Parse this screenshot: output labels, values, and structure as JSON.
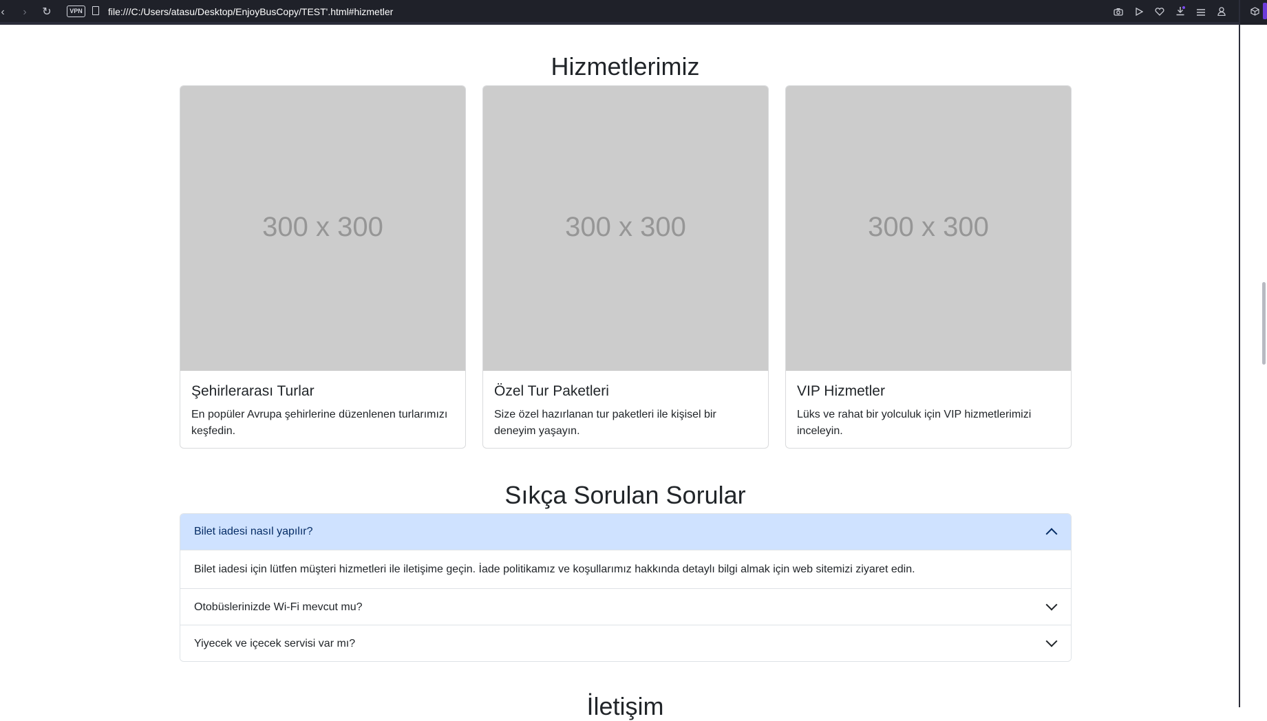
{
  "browser": {
    "back_glyph": "‹",
    "forward_glyph": "›",
    "reload_glyph": "↻",
    "vpn_label": "VPN",
    "url": "file:///C:/Users/atasu/Desktop/EnjoyBusCopy/TEST'.html#hizmetler",
    "toolbar_icons": [
      "camera-icon",
      "play-icon",
      "heart-icon",
      "download-icon",
      "menu-icon",
      "profile-icon",
      "cube-icon"
    ]
  },
  "services": {
    "heading": "Hizmetlerimiz",
    "cards": [
      {
        "image_label": "300 x 300",
        "title": "Şehirlerarası Turlar",
        "text": "En popüler Avrupa şehirlerine düzenlenen turlarımızı keşfedin."
      },
      {
        "image_label": "300 x 300",
        "title": "Özel Tur Paketleri",
        "text": "Size özel hazırlanan tur paketleri ile kişisel bir deneyim yaşayın."
      },
      {
        "image_label": "300 x 300",
        "title": "VIP Hizmetler",
        "text": "Lüks ve rahat bir yolculuk için VIP hizmetlerimizi inceleyin."
      }
    ]
  },
  "faq": {
    "heading": "Sıkça Sorulan Sorular",
    "items": [
      {
        "question": "Bilet iadesi nasıl yapılır?",
        "answer": "Bilet iadesi için lütfen müşteri hizmetleri ile iletişime geçin. İade politikamız ve koşullarımız hakkında detaylı bilgi almak için web sitemizi ziyaret edin.",
        "expanded": true
      },
      {
        "question": "Otobüslerinizde Wi-Fi mevcut mu?",
        "expanded": false
      },
      {
        "question": "Yiyecek ve içecek servisi var mı?",
        "expanded": false
      }
    ]
  },
  "contact": {
    "heading": "İletişim"
  },
  "colors": {
    "accordion_active_bg": "#cfe2ff",
    "placeholder_bg": "#cccccc",
    "browser_bar": "#1f2129"
  }
}
